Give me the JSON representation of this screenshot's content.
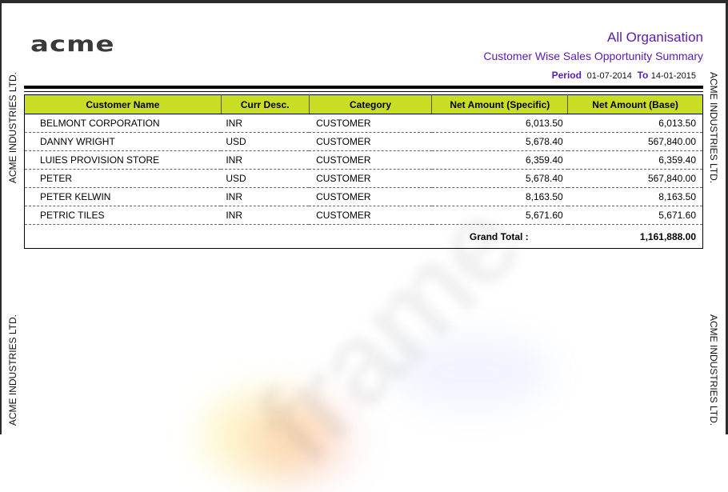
{
  "side_label": "ACME INDUSTRIES LTD.",
  "logo": "acme",
  "header": {
    "organisation": "All Organisation",
    "report_title": "Customer Wise Sales Opportunity Summary",
    "period_label": "Period",
    "period_from": "01-07-2014",
    "period_to_label": "To",
    "period_to": "14-01-2015"
  },
  "table": {
    "columns": [
      "Customer Name",
      "Curr Desc.",
      "Category",
      "Net Amount (Specific)",
      "Net Amount (Base)"
    ],
    "rows": [
      [
        "BELMONT CORPORATION",
        "INR",
        "CUSTOMER",
        "6,013.50",
        "6,013.50"
      ],
      [
        "DANNY WRIGHT",
        "USD",
        "CUSTOMER",
        "5,678.40",
        "567,840.00"
      ],
      [
        "LUIES PROVISION STORE",
        "INR",
        "CUSTOMER",
        "6,359.40",
        "6,359.40"
      ],
      [
        "PETER",
        "USD",
        "CUSTOMER",
        "5,678.40",
        "567,840.00"
      ],
      [
        "PETER KELWIN",
        "INR",
        "CUSTOMER",
        "8,163.50",
        "8,163.50"
      ],
      [
        "PETRIC TILES",
        "INR",
        "CUSTOMER",
        "5,671.60",
        "5,671.60"
      ]
    ],
    "grand_total_label": "Grand Total  :",
    "grand_total_value": "1,161,888.00"
  },
  "watermark": "frame",
  "colors": {
    "header_band": "#c9dd24",
    "title_purple": "#5a1ab5"
  }
}
